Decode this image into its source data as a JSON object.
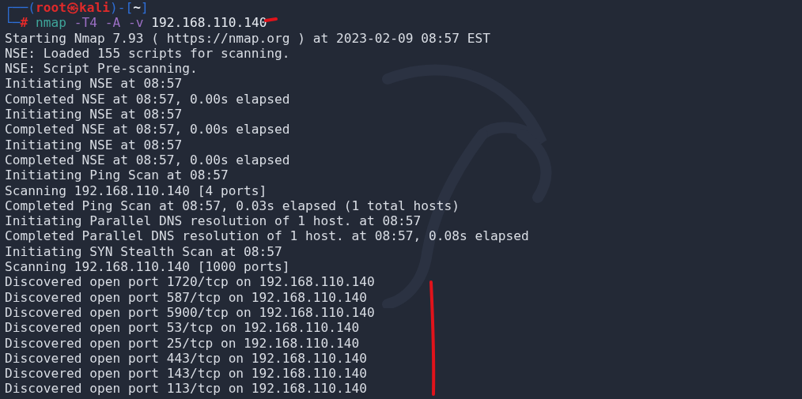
{
  "prompt": [
    {
      "segments": [
        {
          "kind": "frame",
          "text": "┌──("
        },
        {
          "kind": "user",
          "text": "root㉿kali"
        },
        {
          "kind": "frame",
          "text": ")-["
        },
        {
          "kind": "dir",
          "text": "~"
        },
        {
          "kind": "frame",
          "text": "]"
        }
      ]
    },
    {
      "segments": [
        {
          "kind": "frame",
          "text": "└─"
        },
        {
          "kind": "hash",
          "text": "# "
        },
        {
          "kind": "command",
          "text": "nmap"
        },
        {
          "kind": "option",
          "text": " -T4 -A -v"
        },
        {
          "kind": "arg",
          "text": " 192.168.110.140"
        }
      ]
    }
  ],
  "output": [
    "Starting Nmap 7.93 ( https://nmap.org ) at 2023-02-09 08:57 EST",
    "NSE: Loaded 155 scripts for scanning.",
    "NSE: Script Pre-scanning.",
    "Initiating NSE at 08:57",
    "Completed NSE at 08:57, 0.00s elapsed",
    "Initiating NSE at 08:57",
    "Completed NSE at 08:57, 0.00s elapsed",
    "Initiating NSE at 08:57",
    "Completed NSE at 08:57, 0.00s elapsed",
    "Initiating Ping Scan at 08:57",
    "Scanning 192.168.110.140 [4 ports]",
    "Completed Ping Scan at 08:57, 0.03s elapsed (1 total hosts)",
    "Initiating Parallel DNS resolution of 1 host. at 08:57",
    "Completed Parallel DNS resolution of 1 host. at 08:57, 0.08s elapsed",
    "Initiating SYN Stealth Scan at 08:57",
    "Scanning 192.168.110.140 [1000 ports]",
    "Discovered open port 1720/tcp on 192.168.110.140",
    "Discovered open port 587/tcp on 192.168.110.140",
    "Discovered open port 5900/tcp on 192.168.110.140",
    "Discovered open port 53/tcp on 192.168.110.140",
    "Discovered open port 25/tcp on 192.168.110.140",
    "Discovered open port 443/tcp on 192.168.110.140",
    "Discovered open port 143/tcp on 192.168.110.140",
    "Discovered open port 113/tcp on 192.168.110.140"
  ]
}
